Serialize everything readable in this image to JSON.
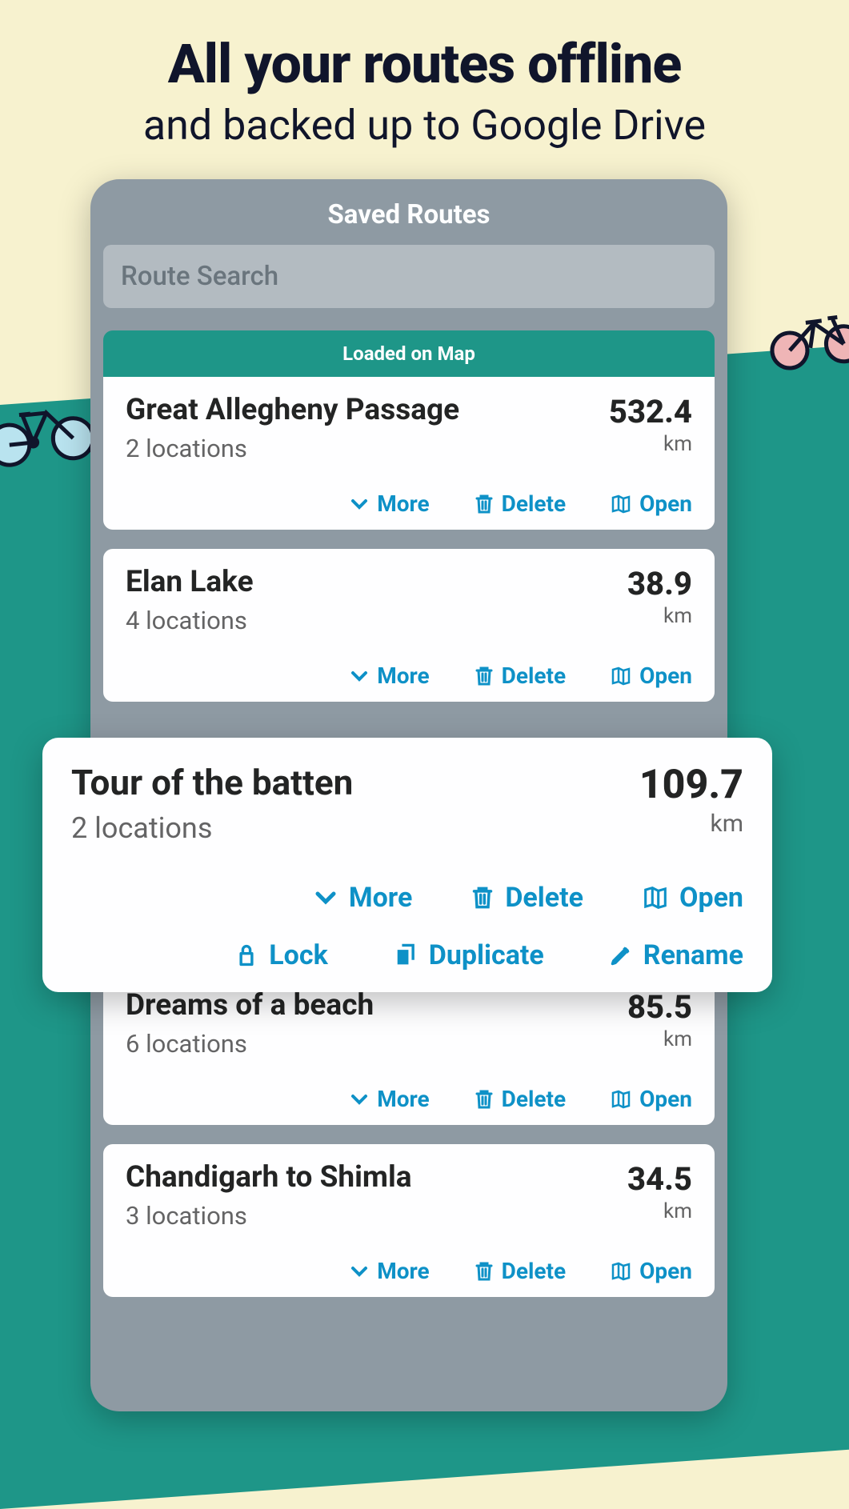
{
  "headline": {
    "bold": "All your routes offline",
    "sub": "and backed up to Google Drive"
  },
  "phone": {
    "title": "Saved Routes",
    "search_placeholder": "Route Search",
    "banner": "Loaded on Map"
  },
  "actions": {
    "more": "More",
    "delete": "Delete",
    "open": "Open",
    "lock": "Lock",
    "duplicate": "Duplicate",
    "rename": "Rename"
  },
  "unit": "km",
  "routes": [
    {
      "name": "Great Allegheny Passage",
      "locations": "2 locations",
      "distance": "532.4"
    },
    {
      "name": "Elan Lake",
      "locations": "4 locations",
      "distance": "38.9"
    },
    {
      "name": "Tour of the batten",
      "locations": "2 locations",
      "distance": "109.7"
    },
    {
      "name": "Dreams of a beach",
      "locations": "6 locations",
      "distance": "85.5"
    },
    {
      "name": "Chandigarh to Shimla",
      "locations": "3 locations",
      "distance": "34.5"
    }
  ]
}
